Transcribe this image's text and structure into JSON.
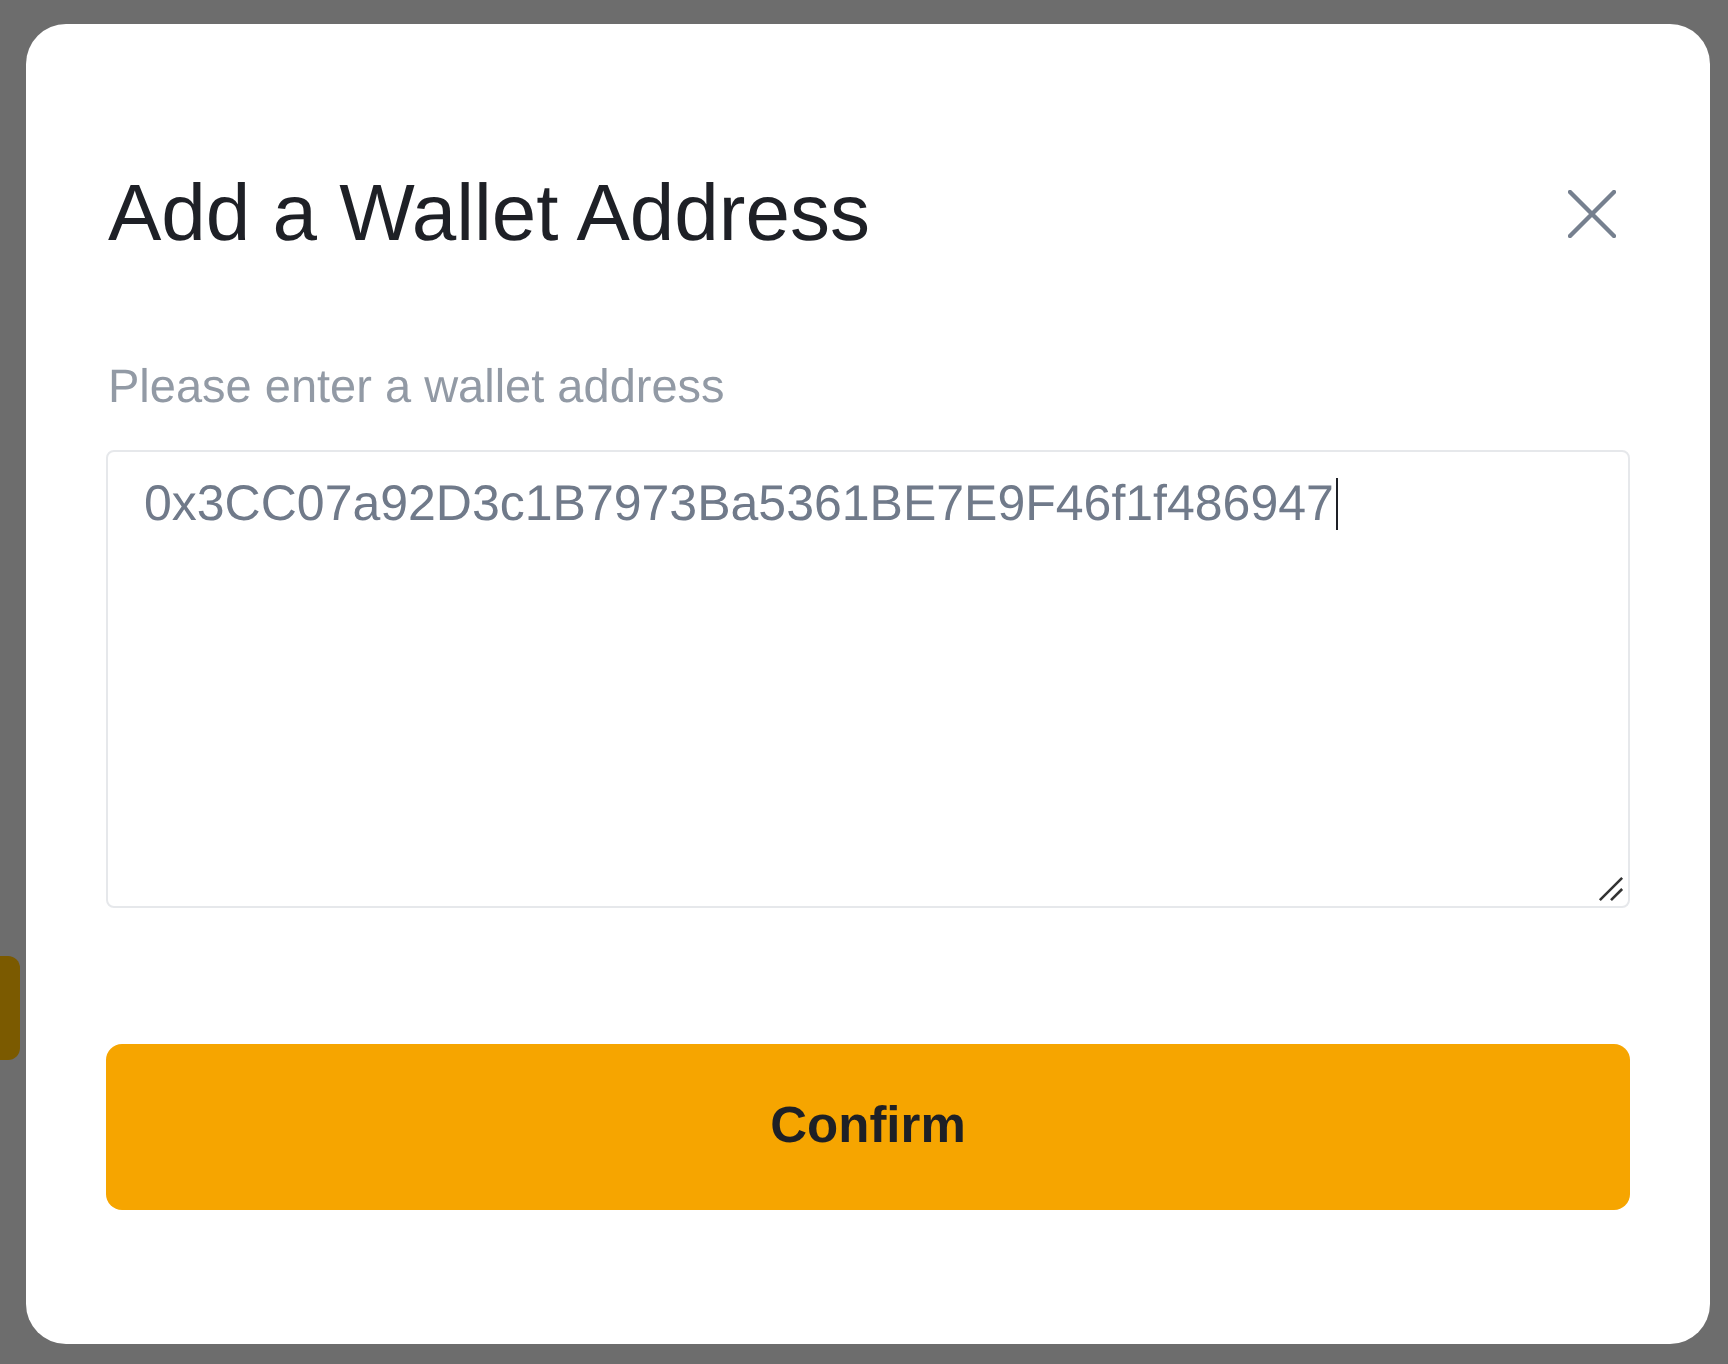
{
  "dialog": {
    "title": "Add a Wallet Address",
    "address_field": {
      "label": "Please enter a wallet address",
      "value": "0x3CC07a92D3c1B7973Ba5361BE7E9F46f1f486947",
      "focused": true
    },
    "confirm_button": {
      "label": "Confirm"
    }
  }
}
